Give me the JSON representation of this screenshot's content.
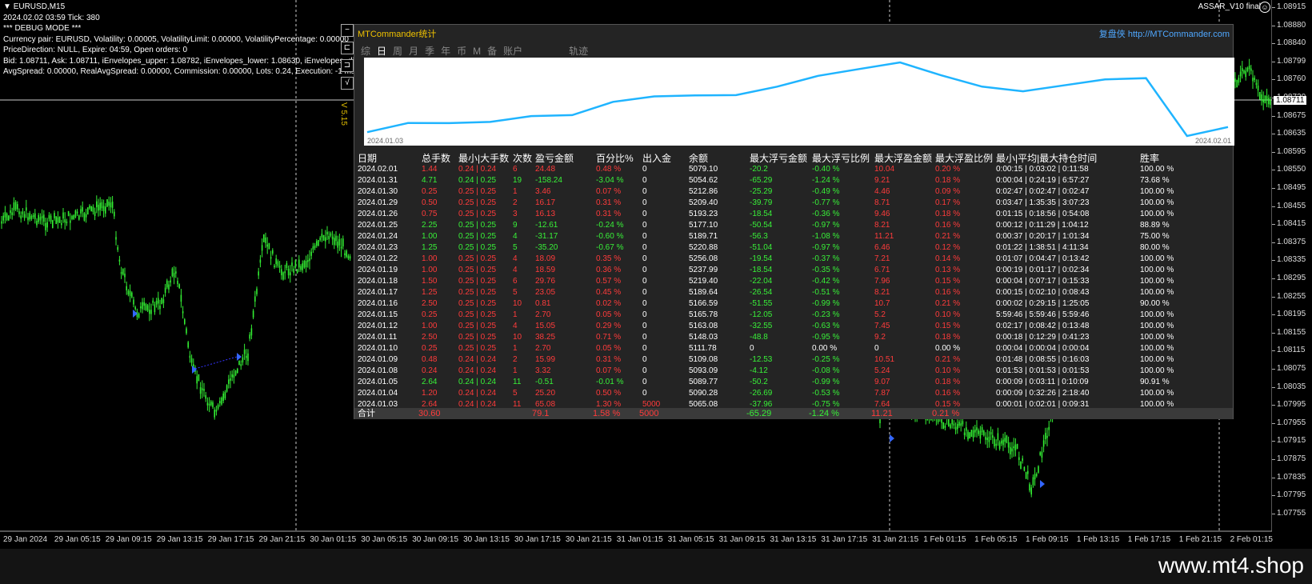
{
  "chart": {
    "symbol_label": "EURUSD,M15",
    "info_lines": [
      "2024.02.02 03:59 Tick: 380",
      "*** DEBUG MODE ***",
      "Currency pair: EURUSD, Volatility: 0.00005, VolatilityLimit: 0.00000, VolatilityPercentage: 0.00000",
      "PriceDirection: NULL, Expire: 04:59, Open orders: 0",
      "Bid: 1.08711, Ask: 1.08711, iEnvelopes_upper: 1.08782, iEnvelopes_lower: 1.08630, iEnvelopes_diff: 0.00152",
      "AvgSpread: 0.00000, RealAvgSpread: 0.00000, Commission: 0.00000, Lots: 0.24, Execution: -1 ms"
    ],
    "ea_name": "ASSAR_V10 final",
    "smiley": "☺",
    "version_label": "V 5.15",
    "side_buttons": [
      "−",
      "⊏",
      "⊐",
      "√"
    ],
    "current_price": "1.08711",
    "price_ticks": [
      "1.08915",
      "1.08880",
      "1.08840",
      "1.08799",
      "1.08760",
      "1.08720",
      "1.08675",
      "1.08635",
      "1.08595",
      "1.08550",
      "1.08495",
      "1.08455",
      "1.08415",
      "1.08375",
      "1.08335",
      "1.08295",
      "1.08255",
      "1.08195",
      "1.08155",
      "1.08115",
      "1.08075",
      "1.08035",
      "1.07995",
      "1.07955",
      "1.07915",
      "1.07875",
      "1.07835",
      "1.07795",
      "1.07755"
    ],
    "time_ticks": [
      "29 Jan 2024",
      "29 Jan 05:15",
      "29 Jan 09:15",
      "29 Jan 13:15",
      "29 Jan 17:15",
      "29 Jan 21:15",
      "30 Jan 01:15",
      "30 Jan 05:15",
      "30 Jan 09:15",
      "30 Jan 13:15",
      "30 Jan 17:15",
      "30 Jan 21:15",
      "31 Jan 01:15",
      "31 Jan 05:15",
      "31 Jan 09:15",
      "31 Jan 13:15",
      "31 Jan 17:15",
      "31 Jan 21:15",
      "1 Feb 01:15",
      "1 Feb 05:15",
      "1 Feb 09:15",
      "1 Feb 13:15",
      "1 Feb 17:15",
      "1 Feb 21:15",
      "2 Feb 01:15"
    ],
    "colors": {
      "candle": "#33ee33",
      "background": "#000000",
      "grid": "#ffffff"
    }
  },
  "panel": {
    "title": "MTCommander统计",
    "brand": "复盘侠 http://MTCommander.com",
    "tabs": [
      "综",
      "日",
      "周",
      "月",
      "季",
      "年",
      "币",
      "M",
      "备",
      "账户",
      "轨迹"
    ],
    "active_tab": "日",
    "curve_start_date": "2024.01.03",
    "curve_end_date": "2024.02.01",
    "headers": [
      "日期",
      "总手数",
      "最小|大手数",
      "次数",
      "盈亏金额",
      "百分比%",
      "出入金",
      "余额",
      "最大浮亏金额",
      "最大浮亏比例",
      "最大浮盈金额",
      "最大浮盈比例",
      "最小|平均|最大持仓时间",
      "胜率"
    ],
    "rows": [
      [
        "2024.02.01",
        "1.44",
        "0.24 | 0.24",
        "6",
        "24.48",
        "0.48 %",
        "0",
        "5079.10",
        "-20.2",
        "-0.40 %",
        "10.04",
        "0.20 %",
        "0:00:15 | 0:03:02 | 0:11:58",
        "100.00 %"
      ],
      [
        "2024.01.31",
        "4.71",
        "0.24 | 0.25",
        "19",
        "-158.24",
        "-3.04 %",
        "0",
        "5054.62",
        "-65.29",
        "-1.24 %",
        "9.21",
        "0.18 %",
        "0:00:04 | 0:24:19 | 6:57:27",
        "73.68 %"
      ],
      [
        "2024.01.30",
        "0.25",
        "0.25 | 0.25",
        "1",
        "3.46",
        "0.07 %",
        "0",
        "5212.86",
        "-25.29",
        "-0.49 %",
        "4.46",
        "0.09 %",
        "0:02:47 | 0:02:47 | 0:02:47",
        "100.00 %"
      ],
      [
        "2024.01.29",
        "0.50",
        "0.25 | 0.25",
        "2",
        "16.17",
        "0.31 %",
        "0",
        "5209.40",
        "-39.79",
        "-0.77 %",
        "8.71",
        "0.17 %",
        "0:03:47 | 1:35:35 | 3:07:23",
        "100.00 %"
      ],
      [
        "2024.01.26",
        "0.75",
        "0.25 | 0.25",
        "3",
        "16.13",
        "0.31 %",
        "0",
        "5193.23",
        "-18.54",
        "-0.36 %",
        "9.46",
        "0.18 %",
        "0:01:15 | 0:18:56 | 0:54:08",
        "100.00 %"
      ],
      [
        "2024.01.25",
        "2.25",
        "0.25 | 0.25",
        "9",
        "-12.61",
        "-0.24 %",
        "0",
        "5177.10",
        "-50.54",
        "-0.97 %",
        "8.21",
        "0.16 %",
        "0:00:12 | 0:11:29 | 1:04:12",
        "88.89 %"
      ],
      [
        "2024.01.24",
        "1.00",
        "0.25 | 0.25",
        "4",
        "-31.17",
        "-0.60 %",
        "0",
        "5189.71",
        "-56.3",
        "-1.08 %",
        "11.21",
        "0.21 %",
        "0:00:37 | 0:20:17 | 1:01:34",
        "75.00 %"
      ],
      [
        "2024.01.23",
        "1.25",
        "0.25 | 0.25",
        "5",
        "-35.20",
        "-0.67 %",
        "0",
        "5220.88",
        "-51.04",
        "-0.97 %",
        "6.46",
        "0.12 %",
        "0:01:22 | 1:38:51 | 4:11:34",
        "80.00 %"
      ],
      [
        "2024.01.22",
        "1.00",
        "0.25 | 0.25",
        "4",
        "18.09",
        "0.35 %",
        "0",
        "5256.08",
        "-19.54",
        "-0.37 %",
        "7.21",
        "0.14 %",
        "0:01:07 | 0:04:47 | 0:13:42",
        "100.00 %"
      ],
      [
        "2024.01.19",
        "1.00",
        "0.25 | 0.25",
        "4",
        "18.59",
        "0.36 %",
        "0",
        "5237.99",
        "-18.54",
        "-0.35 %",
        "6.71",
        "0.13 %",
        "0:00:19 | 0:01:17 | 0:02:34",
        "100.00 %"
      ],
      [
        "2024.01.18",
        "1.50",
        "0.25 | 0.25",
        "6",
        "29.76",
        "0.57 %",
        "0",
        "5219.40",
        "-22.04",
        "-0.42 %",
        "7.96",
        "0.15 %",
        "0:00:04 | 0:07:17 | 0:15:33",
        "100.00 %"
      ],
      [
        "2024.01.17",
        "1.25",
        "0.25 | 0.25",
        "5",
        "23.05",
        "0.45 %",
        "0",
        "5189.64",
        "-26.54",
        "-0.51 %",
        "8.21",
        "0.16 %",
        "0:00:15 | 0:02:10 | 0:08:43",
        "100.00 %"
      ],
      [
        "2024.01.16",
        "2.50",
        "0.25 | 0.25",
        "10",
        "0.81",
        "0.02 %",
        "0",
        "5166.59",
        "-51.55",
        "-0.99 %",
        "10.7",
        "0.21 %",
        "0:00:02 | 0:29:15 | 1:25:05",
        "90.00 %"
      ],
      [
        "2024.01.15",
        "0.25",
        "0.25 | 0.25",
        "1",
        "2.70",
        "0.05 %",
        "0",
        "5165.78",
        "-12.05",
        "-0.23 %",
        "5.2",
        "0.10 %",
        "5:59:46 | 5:59:46 | 5:59:46",
        "100.00 %"
      ],
      [
        "2024.01.12",
        "1.00",
        "0.25 | 0.25",
        "4",
        "15.05",
        "0.29 %",
        "0",
        "5163.08",
        "-32.55",
        "-0.63 %",
        "7.45",
        "0.15 %",
        "0:02:17 | 0:08:42 | 0:13:48",
        "100.00 %"
      ],
      [
        "2024.01.11",
        "2.50",
        "0.25 | 0.25",
        "10",
        "38.25",
        "0.71 %",
        "0",
        "5148.03",
        "-48.8",
        "-0.95 %",
        "9.2",
        "0.18 %",
        "0:00:18 | 0:12:29 | 0:41:23",
        "100.00 %"
      ],
      [
        "2024.01.10",
        "0.25",
        "0.25 | 0.25",
        "1",
        "2.70",
        "0.05 %",
        "0",
        "5111.78",
        "0",
        "0.00 %",
        "0",
        "0.00 %",
        "0:00:04 | 0:00:04 | 0:00:04",
        "100.00 %"
      ],
      [
        "2024.01.09",
        "0.48",
        "0.24 | 0.24",
        "2",
        "15.99",
        "0.31 %",
        "0",
        "5109.08",
        "-12.53",
        "-0.25 %",
        "10.51",
        "0.21 %",
        "0:01:48 | 0:08:55 | 0:16:03",
        "100.00 %"
      ],
      [
        "2024.01.08",
        "0.24",
        "0.24 | 0.24",
        "1",
        "3.32",
        "0.07 %",
        "0",
        "5093.09",
        "-4.12",
        "-0.08 %",
        "5.24",
        "0.10 %",
        "0:01:53 | 0:01:53 | 0:01:53",
        "100.00 %"
      ],
      [
        "2024.01.05",
        "2.64",
        "0.24 | 0.24",
        "11",
        "-0.51",
        "-0.01 %",
        "0",
        "5089.77",
        "-50.2",
        "-0.99 %",
        "9.07",
        "0.18 %",
        "0:00:09 | 0:03:11 | 0:10:09",
        "90.91 %"
      ],
      [
        "2024.01.04",
        "1.20",
        "0.24 | 0.24",
        "5",
        "25.20",
        "0.50 %",
        "0",
        "5090.28",
        "-26.69",
        "-0.53 %",
        "7.87",
        "0.16 %",
        "0:00:09 | 0:32:26 | 2:18:40",
        "100.00 %"
      ],
      [
        "2024.01.03",
        "2.64",
        "0.24 | 0.24",
        "11",
        "65.08",
        "1.30 %",
        "5000",
        "5065.08",
        "-37.96",
        "-0.75 %",
        "7.64",
        "0.15 %",
        "0:00:01 | 0:02:01 | 0:09:31",
        "100.00 %"
      ]
    ],
    "total": {
      "label": "合计",
      "lots": "30.60",
      "pnl": "79.1",
      "percent": "1.58 %",
      "deposit": "5000",
      "max_float_loss": "-65.29",
      "max_float_loss_pct": "-1.24 %",
      "max_float_profit": "11.21",
      "max_float_profit_pct": "0.21 %"
    },
    "colors": {
      "title": "#f0c200",
      "brand": "#4fa8ff",
      "profit": "#ff3b3b",
      "loss": "#38f038",
      "curve": "#1fb4ff"
    }
  },
  "footer": {
    "text": "www.mt4.shop"
  }
}
